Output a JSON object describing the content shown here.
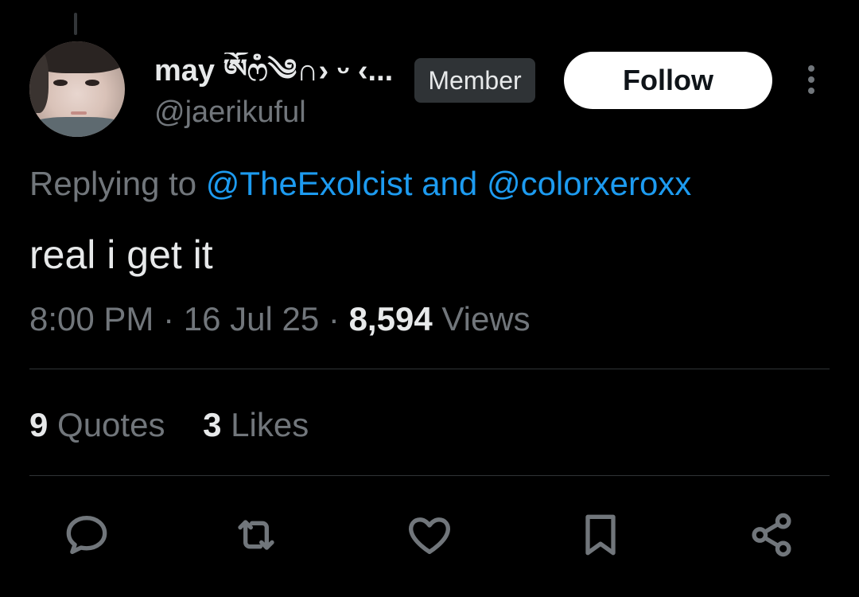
{
  "tweet": {
    "display_name": "may ༀෆໍ༄∩› ᵕ ‹...",
    "handle": "@jaerikuful",
    "badge": "Member",
    "follow_label": "Follow",
    "replying_prefix": "Replying to",
    "reply_to_1": "@TheExolcist",
    "reply_joiner": "and",
    "reply_to_2": "@colorxeroxx",
    "text": "real i get it",
    "time": "8:00 PM",
    "sep": "·",
    "date": "16 Jul 25",
    "views_count": "8,594",
    "views_label": "Views",
    "quotes_count": "9",
    "quotes_label": "Quotes",
    "likes_count": "3",
    "likes_label": "Likes"
  },
  "icons": {
    "more": "more-vertical-icon",
    "reply": "reply-icon",
    "repost": "repost-icon",
    "like": "heart-icon",
    "bookmark": "bookmark-icon",
    "share": "share-icon"
  },
  "colors": {
    "background": "#000000",
    "text": "#e7e9ea",
    "muted": "#71767b",
    "link": "#1d9bf0",
    "badge_bg": "#2f3336",
    "follow_bg": "#ffffff"
  }
}
